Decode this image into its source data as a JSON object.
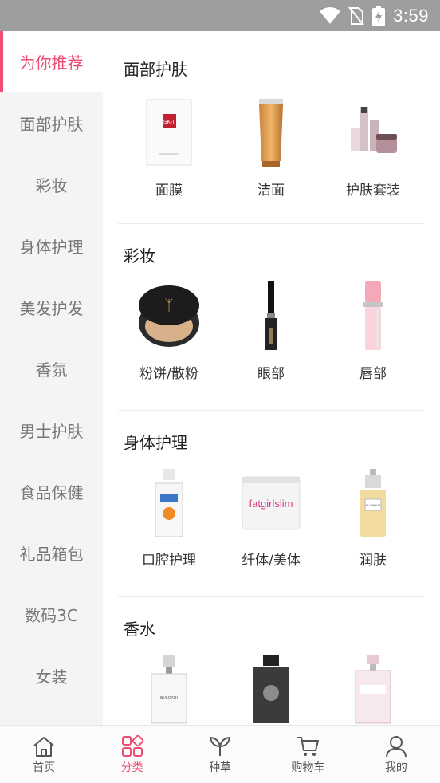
{
  "status_bar": {
    "time": "3:59",
    "icons": [
      "wifi-icon",
      "no-sim-icon",
      "battery-charging-icon"
    ]
  },
  "colors": {
    "accent": "#ef4b73",
    "sidebar_bg": "#f4f4f4",
    "status_bar_bg": "#9e9e9e"
  },
  "sidebar": {
    "items": [
      {
        "label": "为你推荐",
        "active": true
      },
      {
        "label": "面部护肤"
      },
      {
        "label": "彩妆"
      },
      {
        "label": "身体护理"
      },
      {
        "label": "美发护发"
      },
      {
        "label": "香氛"
      },
      {
        "label": "男士护肤"
      },
      {
        "label": "食品保健"
      },
      {
        "label": "礼品箱包"
      },
      {
        "label": "数码3C"
      },
      {
        "label": "女装"
      }
    ]
  },
  "sections": [
    {
      "title": "面部护肤",
      "items": [
        {
          "label": "面膜"
        },
        {
          "label": "洁面"
        },
        {
          "label": "护肤套装"
        }
      ]
    },
    {
      "title": "彩妆",
      "items": [
        {
          "label": "粉饼/散粉"
        },
        {
          "label": "眼部"
        },
        {
          "label": "唇部"
        }
      ]
    },
    {
      "title": "身体护理",
      "items": [
        {
          "label": "口腔护理"
        },
        {
          "label": "纤体/美体"
        },
        {
          "label": "润肤"
        }
      ]
    },
    {
      "title": "香水",
      "items": [
        {
          "label": ""
        },
        {
          "label": ""
        },
        {
          "label": ""
        }
      ]
    }
  ],
  "product_image_text": {
    "mask_brand": "SK-II",
    "slimming_brand": "fatgirlslim",
    "moisturizer_brand": "CLINIQUE",
    "perfume_brand_1": "BVLGARI"
  },
  "tabbar": {
    "tabs": [
      {
        "label": "首页",
        "icon": "home-icon"
      },
      {
        "label": "分类",
        "icon": "category-icon",
        "active": true
      },
      {
        "label": "种草",
        "icon": "sprout-icon"
      },
      {
        "label": "购物车",
        "icon": "cart-icon"
      },
      {
        "label": "我的",
        "icon": "profile-icon"
      }
    ]
  }
}
